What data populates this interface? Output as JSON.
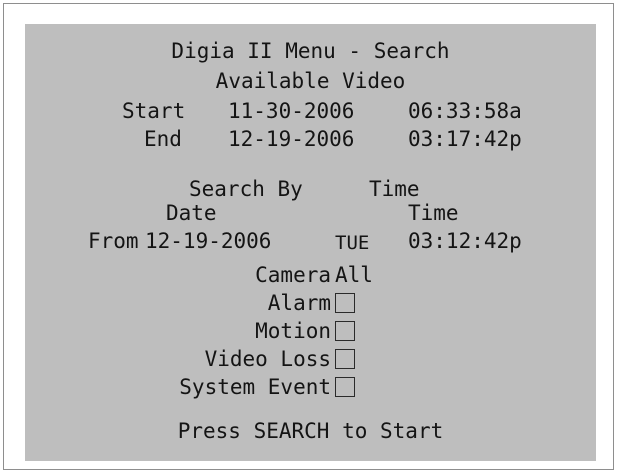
{
  "menu": {
    "title": "Digia II Menu - Search",
    "available_video_label": "Available Video",
    "start_label": "Start",
    "start_date": "11-30-2006",
    "start_time": "06:33:58a",
    "end_label": "End",
    "end_date": "12-19-2006",
    "end_time": "03:17:42p"
  },
  "search": {
    "search_by_label": "Search By",
    "search_by_value": "Time",
    "date_header": "Date",
    "time_header": "Time",
    "from_label": "From",
    "from_date": "12-19-2006",
    "from_day": "TUE",
    "from_time": "03:12:42p"
  },
  "filters": {
    "camera_label": "Camera",
    "camera_value": "All",
    "alarm_label": "Alarm",
    "alarm_checked": false,
    "motion_label": "Motion",
    "motion_checked": false,
    "video_loss_label": "Video Loss",
    "video_loss_checked": false,
    "system_event_label": "System Event",
    "system_event_checked": false
  },
  "footer": {
    "instruction": "Press SEARCH to Start"
  },
  "colors": {
    "screen_background": "#bebebe",
    "text": "#141414",
    "frame_border": "#8e8e8e"
  }
}
